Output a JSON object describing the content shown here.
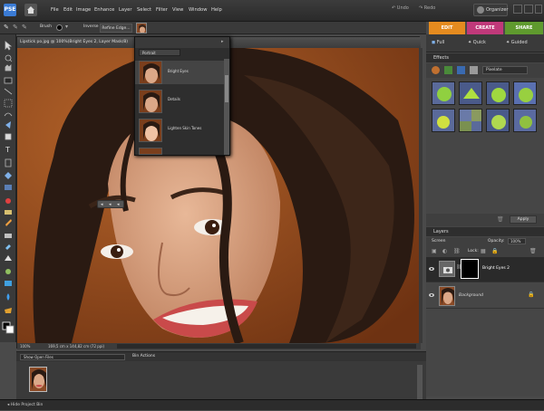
{
  "app": {
    "logo_text": "PSE"
  },
  "menu": [
    "File",
    "Edit",
    "Image",
    "Enhance",
    "Layer",
    "Select",
    "Filter",
    "View",
    "Window",
    "Help"
  ],
  "top_right": {
    "undo": "Undo",
    "redo": "Redo",
    "organizer": "Organizer"
  },
  "options_bar": {
    "tool_label": "Brush",
    "inverse": "Inverse",
    "refine_edge": "Refine Edge..."
  },
  "mode_tabs": [
    "EDIT",
    "CREATE",
    "SHARE"
  ],
  "sub_tabs": [
    "Full",
    "Quick",
    "Guided"
  ],
  "document": {
    "title": "Lipstick po.jpg @ 100%(Bright Eyes 2, Layer Mask/8)",
    "zoom": "100%",
    "dimensions": "169,5 cm x 144,82 cm (72 ppi)"
  },
  "popup": {
    "category": "Portrait",
    "items": [
      "Bright Eyes",
      "Details",
      "Lighten Skin Tones"
    ]
  },
  "effects": {
    "header": "Effects",
    "category": "Pixelate",
    "apply_label": "Apply"
  },
  "layers": {
    "header": "Layers",
    "blend_mode": "Screen",
    "opacity_label": "Opacity:",
    "opacity_value": "100%",
    "lock_label": "Lock:",
    "items": [
      {
        "name": "Bright Eyes 2"
      },
      {
        "name": "Background"
      }
    ]
  },
  "bin": {
    "dropdown": "Show Open Files",
    "actions_label": "Bin Actions"
  },
  "status": {
    "hide_bin": "Hide Project Bin"
  },
  "colors": {
    "edit": "#e58b1f",
    "create": "#c0397a",
    "share": "#5f9a2e",
    "accent": "#3a7bd5"
  }
}
